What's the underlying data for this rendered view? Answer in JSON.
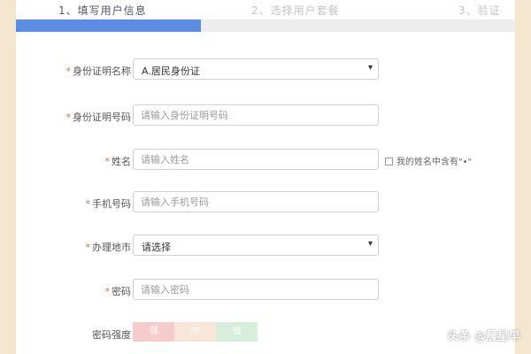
{
  "steps": [
    {
      "label": "1、填写用户信息"
    },
    {
      "label": "2、选择用户套餐"
    },
    {
      "label": "3、验证"
    }
  ],
  "progress": {
    "fraction": 0.37,
    "color": "#5a8de3"
  },
  "form": {
    "id_type": {
      "label": "身份证明名称",
      "value": "A.居民身份证"
    },
    "id_number": {
      "label": "身份证明号码",
      "placeholder": "请输入身份证明号码"
    },
    "name": {
      "label": "姓名",
      "placeholder": "请输入姓名",
      "checkbox_label": "我的姓名中含有\"•\""
    },
    "phone": {
      "label": "手机号码",
      "placeholder": "请输入手机号码"
    },
    "channel": {
      "label": "办理地市",
      "value": "请选择"
    },
    "password": {
      "label": "密码",
      "placeholder": "请输入密码"
    },
    "strength": {
      "label": "密码强度",
      "weak": "弱",
      "medium": "中",
      "strong": "强"
    }
  },
  "watermark": "头条 @晨星早",
  "icons": {
    "dropdown": "caret-down-icon"
  }
}
